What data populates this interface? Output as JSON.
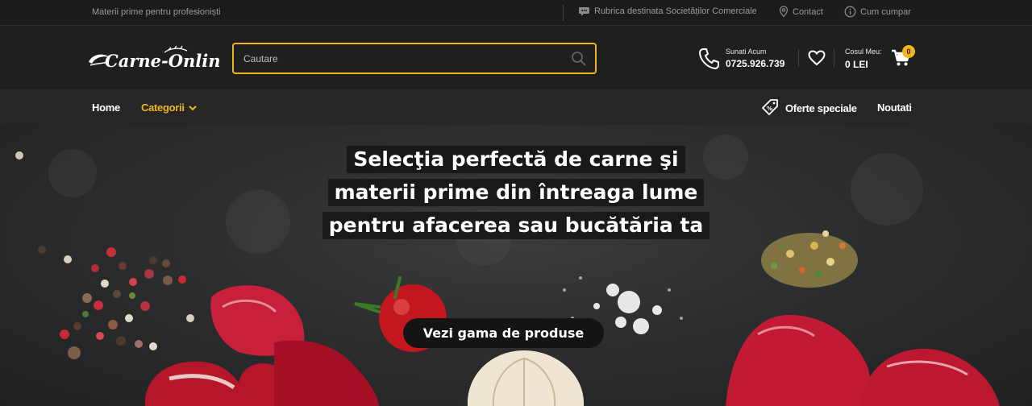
{
  "topbar": {
    "tagline": "Materii prime pentru profesioniști",
    "links": [
      {
        "label": "Rubrica destinata Societăților Comerciale",
        "icon": "chat-bubble-icon"
      },
      {
        "label": "Contact",
        "icon": "location-pin-icon"
      },
      {
        "label": "Cum cumpar",
        "icon": "info-icon"
      }
    ]
  },
  "header": {
    "logo_text": "Carne-Online",
    "search": {
      "placeholder": "Cautare",
      "value": ""
    },
    "phone": {
      "label": "Sunati Acum",
      "number": "0725.926.739"
    },
    "cart": {
      "label": "Cosul Meu:",
      "total": "0 LEI",
      "count": "0"
    }
  },
  "nav": {
    "home": "Home",
    "categories": "Categorii",
    "offers": "Oferte speciale",
    "news": "Noutati"
  },
  "hero": {
    "title_lines": [
      "Selecţia perfectă de carne şi",
      "materii prime din întreaga lume",
      "pentru afacerea sau bucătăria ta"
    ],
    "cta": "Vezi gama de produse"
  },
  "colors": {
    "accent": "#f0b51a",
    "header_bg": "#1f1f1f",
    "nav_bg": "#262626",
    "topbar_bg": "#1b1b1b"
  }
}
